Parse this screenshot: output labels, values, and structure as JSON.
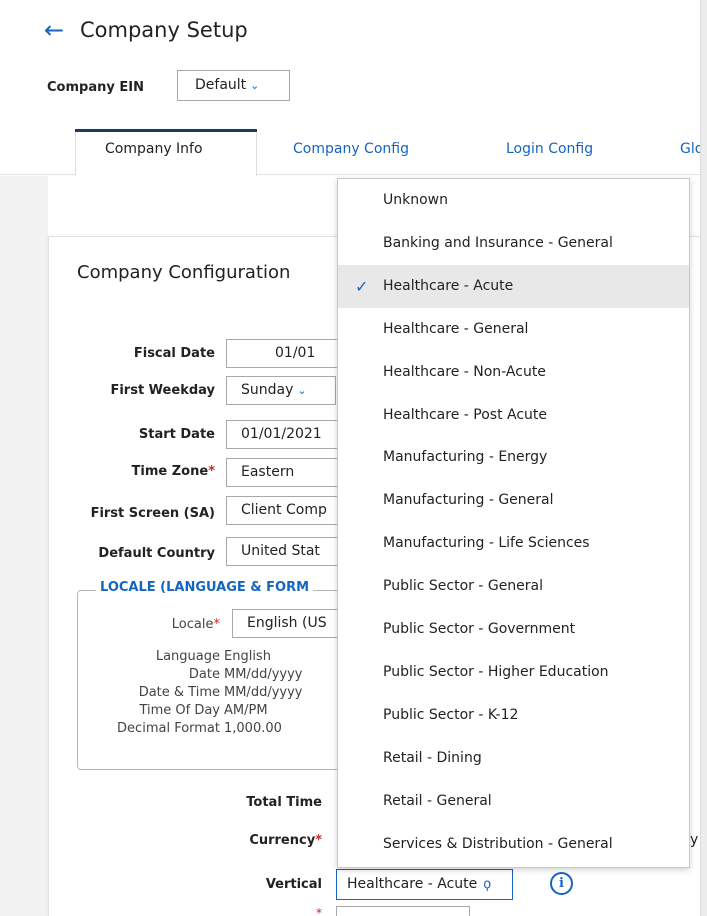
{
  "header": {
    "title": "Company Setup",
    "ein_label": "Company EIN",
    "ein_value": "Default"
  },
  "tabs": [
    {
      "label": "Company Info",
      "active": true
    },
    {
      "label": "Company Config",
      "active": false
    },
    {
      "label": "Login Config",
      "active": false
    },
    {
      "label": "Glo",
      "active": false
    }
  ],
  "card": {
    "title": "Company Configuration"
  },
  "fields": {
    "fiscal_date": {
      "label": "Fiscal Date",
      "value": "01/01"
    },
    "first_weekday": {
      "label": "First Weekday",
      "value": "Sunday"
    },
    "start_date": {
      "label": "Start Date",
      "value": "01/01/2021"
    },
    "time_zone": {
      "label": "Time Zone",
      "required_mark": "*",
      "value": "Eastern"
    },
    "first_screen": {
      "label": "First Screen (SA)",
      "value": "Client Comp"
    },
    "default_country": {
      "label": "Default Country",
      "value": "United Stat"
    }
  },
  "locale": {
    "legend": "LOCALE (LANGUAGE & FORM",
    "locale_label": "Locale",
    "required_mark": "*",
    "locale_value": "English (US",
    "rows": [
      {
        "label": "Language",
        "value": "English"
      },
      {
        "label": "Date",
        "value": "MM/dd/yyyy"
      },
      {
        "label": "Date & Time",
        "value": "MM/dd/yyyy"
      },
      {
        "label": "Time Of Day",
        "value": "AM/PM"
      },
      {
        "label": "Decimal Format",
        "value": "1,000.00"
      }
    ]
  },
  "lower_fields": {
    "total_time_label": "Total Time",
    "currency_label": "Currency",
    "currency_required": "*",
    "vertical_label": "Vertical",
    "vertical_value": "Healthcare - Acute",
    "stray_text": "y"
  },
  "dropdown": {
    "selected_index": 2,
    "options": [
      "Unknown",
      "Banking and Insurance - General",
      "Healthcare - Acute",
      "Healthcare - General",
      "Healthcare - Non-Acute",
      "Healthcare - Post Acute",
      "Manufacturing - Energy",
      "Manufacturing - General",
      "Manufacturing - Life Sciences",
      "Public Sector - General",
      "Public Sector - Government",
      "Public Sector - Higher Education",
      "Public Sector - K-12",
      "Retail - Dining",
      "Retail - General",
      "Services & Distribution - General"
    ]
  },
  "icons": {
    "back": "arrow-left-icon",
    "chevron": "chevron-down-icon",
    "check": "check-icon",
    "info": "info-icon",
    "fork": "fork-icon"
  },
  "colors": {
    "accent": "#1565c0",
    "required": "#c62828",
    "tab_indicator": "#1d3a5f",
    "selected_bg": "#e8e8e8"
  }
}
